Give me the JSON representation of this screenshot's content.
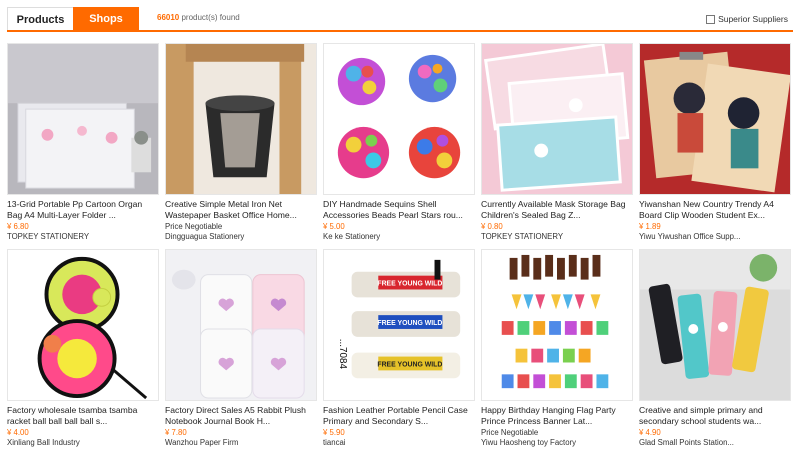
{
  "tabs": {
    "products": "Products",
    "shops": "Shops"
  },
  "results": {
    "count": "66010",
    "suffix": " product(s) found"
  },
  "superior_label": "Superior Suppliers",
  "products": [
    {
      "title": "13-Grid Portable Pp Cartoon Organ Bag A4 Multi-Layer Folder ...",
      "price": "¥ 6.80",
      "seller": "TOPKEY STATIONERY",
      "icon": "folder-organizer-image"
    },
    {
      "title": "Creative Simple Metal Iron Net Wastepaper Basket Office Home...",
      "price": "Price Negotiable",
      "seller": "Dingguagua Stationery",
      "icon": "wastebasket-image"
    },
    {
      "title": "DIY Handmade Sequins Shell Accessories Beads Pearl Stars rou...",
      "price": "¥ 5.00",
      "seller": "Ke ke Stationery",
      "icon": "sequins-image"
    },
    {
      "title": "Currently Available Mask Storage Bag Children's Sealed Bag Z...",
      "price": "¥ 0.80",
      "seller": "TOPKEY STATIONERY",
      "icon": "mask-bag-image"
    },
    {
      "title": "Yiwanshan New Country Trendy A4 Board Clip Wooden Student Ex...",
      "price": "¥ 1.89",
      "seller": "Yiwu Yiwushan Office Supp...",
      "icon": "board-clip-image"
    },
    {
      "title": "Factory wholesale tsamba tsamba racket ball ball ball ball s...",
      "price": "¥ 4.00",
      "seller": "Xinliang Ball Industry",
      "icon": "racket-ball-image"
    },
    {
      "title": "Factory Direct Sales A5 Rabbit Plush Notebook Journal Book H...",
      "price": "¥ 7.80",
      "seller": "Wanzhou Paper Firm",
      "icon": "rabbit-notebook-image"
    },
    {
      "title": "Fashion Leather Portable Pencil Case Primary and Secondary S...",
      "price": "¥ 5.90",
      "seller": "tiancai",
      "icon": "pencil-case-image"
    },
    {
      "title": "Happy Birthday Hanging Flag Party Prince Princess Banner Lat...",
      "price": "Price Negotiable",
      "seller": "Yiwu Haosheng toy Factory",
      "icon": "birthday-banner-image"
    },
    {
      "title": "Creative and simple primary and secondary school students wa...",
      "price": "¥ 4.90",
      "seller": "Glad Small Points Station...",
      "icon": "pencil-boxes-image"
    }
  ],
  "image_text": {
    "pencil_band": "FREE YOUNG WILD",
    "pencil_case_side": "...7084"
  }
}
